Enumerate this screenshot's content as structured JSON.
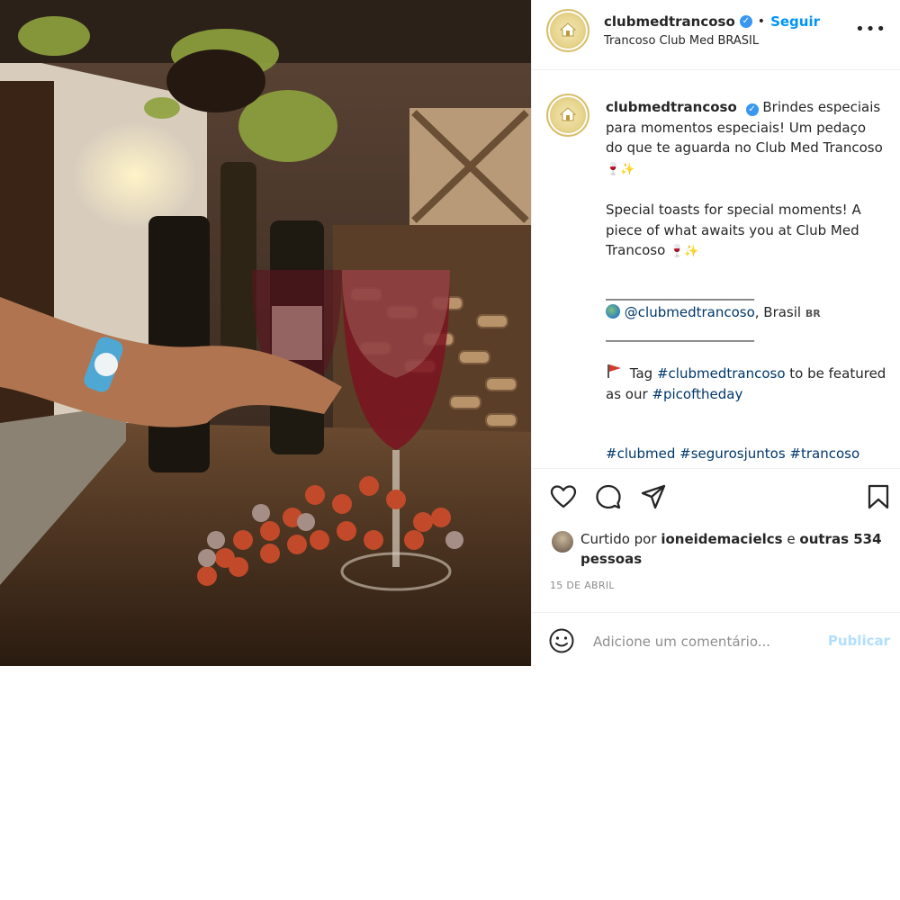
{
  "post": {
    "username": "clubmedtrancoso",
    "follow_label": "Seguir",
    "separator": "•",
    "location": "Trancoso Club Med BRASIL",
    "more_label": "•••"
  },
  "caption": {
    "username": "clubmedtrancoso",
    "pt_text": "Brindes especiais para momentos especiais! Um pedaço do que te aguarda no Club Med Trancoso",
    "pt_emoji": "🍷✨",
    "en_text": "Special toasts for special moments! A piece of what awaits you at Club Med Trancoso",
    "en_emoji": "🍷✨",
    "rule": "______________________",
    "mention": "@clubmedtrancoso",
    "mention_suffix": ", Brasil",
    "country_code": "BR",
    "tag_prefix": "Tag",
    "tag_handle": "#clubmedtrancoso",
    "tag_middle": "to be featured as our",
    "tag_hashtag": "#picoftheday",
    "hashtags": "#clubmed #segurosjuntos #trancoso"
  },
  "likes": {
    "prefix": "Curtido por",
    "user": "ioneidemacielcs",
    "mid": "e",
    "others": "outras 534 pessoas"
  },
  "date": "15 DE ABRIL",
  "comment": {
    "placeholder": "Adicione um comentário...",
    "publish_label": "Publicar"
  },
  "icons": {
    "like": "heart-icon",
    "comment": "comment-icon",
    "share": "share-icon",
    "save": "bookmark-icon",
    "emoji": "smiley-icon",
    "verified": "verified-badge-icon"
  },
  "colors": {
    "link": "#0095f6",
    "hashtag": "#00376b",
    "muted": "#8e8e8e",
    "publish_disabled": "#b2dffc",
    "text": "#262626"
  }
}
